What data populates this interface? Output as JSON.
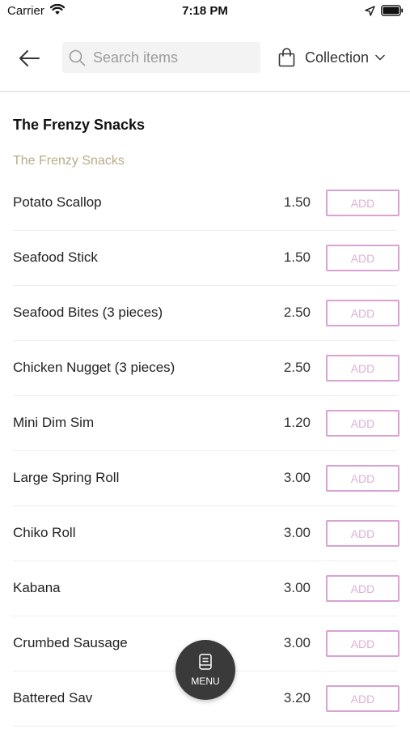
{
  "status_bar": {
    "carrier": "Carrier",
    "time": "7:18 PM",
    "icons": [
      "wifi-icon",
      "location-arrow-icon",
      "battery-icon"
    ]
  },
  "header": {
    "back_icon": "arrow-left-icon",
    "search": {
      "placeholder": "Search items",
      "value": ""
    },
    "collection": {
      "label": "Collection",
      "icon": "shopping-bag-icon"
    }
  },
  "menu": {
    "title": "The Frenzy Snacks",
    "category": "The Frenzy Snacks",
    "add_label": "ADD",
    "items": [
      {
        "name": "Potato Scallop",
        "price": "1.50"
      },
      {
        "name": "Seafood Stick",
        "price": "1.50"
      },
      {
        "name": "Seafood Bites (3 pieces)",
        "price": "2.50"
      },
      {
        "name": "Chicken Nugget (3 pieces)",
        "price": "2.50"
      },
      {
        "name": "Mini Dim Sim",
        "price": "1.20"
      },
      {
        "name": "Large Spring Roll",
        "price": "3.00"
      },
      {
        "name": "Chiko Roll",
        "price": "3.00"
      },
      {
        "name": "Kabana",
        "price": "3.00"
      },
      {
        "name": "Crumbed Sausage",
        "price": "3.00"
      },
      {
        "name": "Battered Sav",
        "price": "3.20"
      }
    ]
  },
  "fab": {
    "label": "MENU",
    "icon": "menu-book-icon"
  },
  "colors": {
    "accent": "#d9a2d3",
    "category": "#b6ad86",
    "fab_background": "#3a3a3a"
  }
}
